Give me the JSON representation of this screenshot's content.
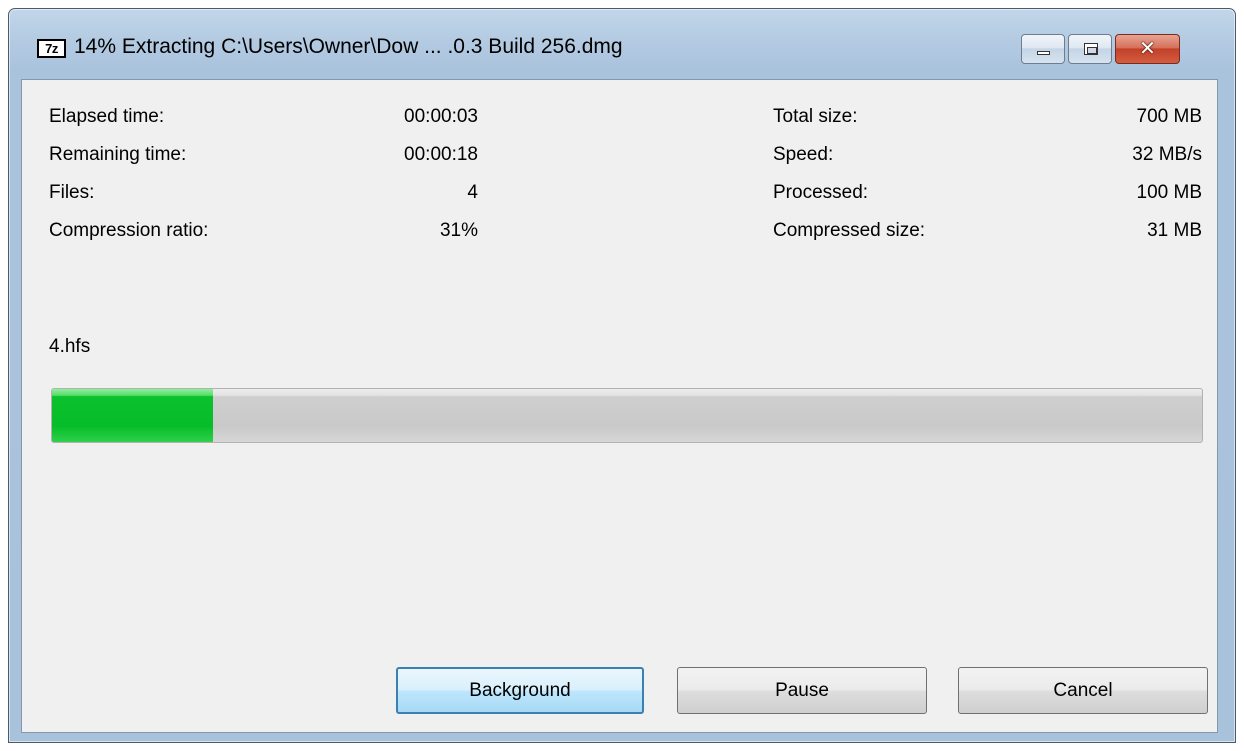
{
  "window": {
    "app_icon_text": "7z",
    "title": "14% Extracting C:\\Users\\Owner\\Dow ... .0.3 Build 256.dmg",
    "controls": {
      "minimize": "minimize-icon",
      "maximize": "maximize-icon",
      "close": "✕"
    }
  },
  "stats": {
    "left": [
      {
        "label": "Elapsed time:",
        "value": "00:00:03"
      },
      {
        "label": "Remaining time:",
        "value": "00:00:18"
      },
      {
        "label": "Files:",
        "value": "4"
      },
      {
        "label": "Compression ratio:",
        "value": "31%"
      }
    ],
    "right": [
      {
        "label": "Total size:",
        "value": "700 MB"
      },
      {
        "label": "Speed:",
        "value": "32 MB/s"
      },
      {
        "label": "Processed:",
        "value": "100 MB"
      },
      {
        "label": "Compressed size:",
        "value": "31 MB"
      }
    ]
  },
  "current_file": "4.hfs",
  "progress": {
    "fraction": 0.14,
    "fill_color": "#06bd29"
  },
  "buttons": {
    "background": "Background",
    "pause": "Pause",
    "cancel": "Cancel"
  }
}
